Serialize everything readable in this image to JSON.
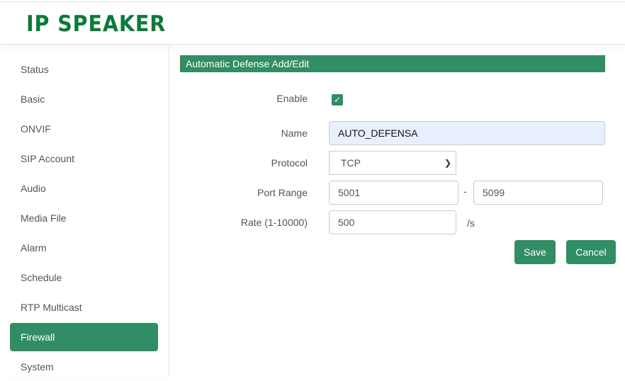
{
  "header": {
    "logo": "IP SPEAKER"
  },
  "sidebar": {
    "items": [
      {
        "label": "Status"
      },
      {
        "label": "Basic"
      },
      {
        "label": "ONVIF"
      },
      {
        "label": "SIP Account"
      },
      {
        "label": "Audio"
      },
      {
        "label": "Media File"
      },
      {
        "label": "Alarm"
      },
      {
        "label": "Schedule"
      },
      {
        "label": "RTP Multicast"
      },
      {
        "label": "Firewall",
        "active": true
      },
      {
        "label": "System"
      }
    ]
  },
  "form": {
    "title": "Automatic Defense Add/Edit",
    "enable_label": "Enable",
    "enable_checked": true,
    "check_glyph": "✓",
    "name_label": "Name",
    "name_value": "AUTO_DEFENSA",
    "protocol_label": "Protocol",
    "protocol_value": "TCP",
    "port_label": "Port Range",
    "port_from": "5001",
    "port_sep": "-",
    "port_to": "5099",
    "rate_label": "Rate (1-10000)",
    "rate_value": "500",
    "rate_unit": "/s",
    "save": "Save",
    "cancel": "Cancel"
  },
  "colors": {
    "accent": "#318d63",
    "logo": "#0b7a3b"
  }
}
